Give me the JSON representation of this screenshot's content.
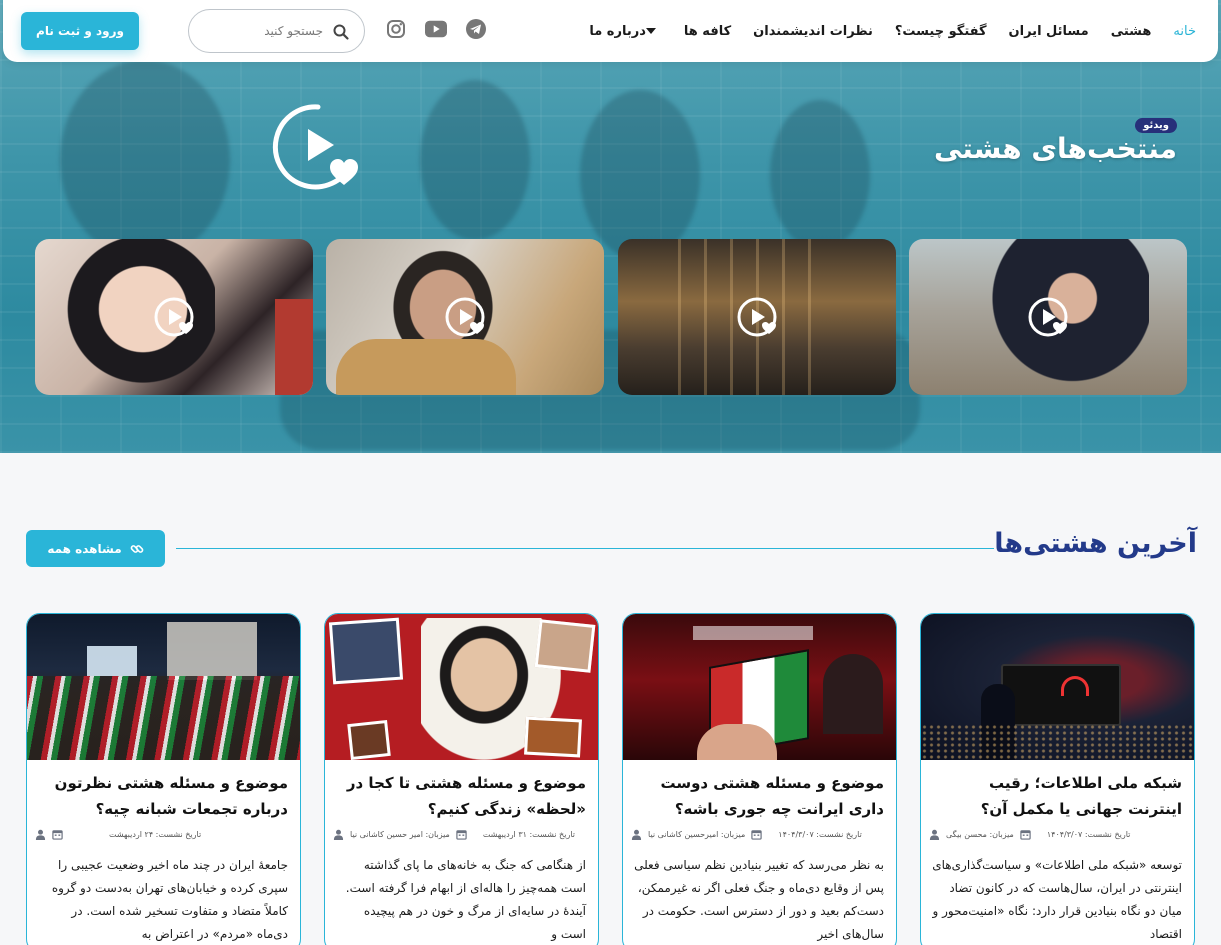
{
  "nav": {
    "links": [
      {
        "label": "خانه",
        "active": true
      },
      {
        "label": "هشتی"
      },
      {
        "label": "مسائل ایران"
      },
      {
        "label": "گفتگو چیست؟"
      },
      {
        "label": "نظرات اندیشمندان"
      },
      {
        "label": "کافه ها"
      },
      {
        "label": "درباره ما"
      }
    ],
    "search_placeholder": "جستجو کنید",
    "login_label": "ورود و ثبت نام",
    "socials": [
      "telegram-icon",
      "youtube-icon",
      "instagram-icon"
    ],
    "accent": "#2ab5d8"
  },
  "hero": {
    "badge": "ویدئو",
    "title": "منتخب‌های هشتی",
    "videos": [
      {
        "id": "v1"
      },
      {
        "id": "v2"
      },
      {
        "id": "v3"
      },
      {
        "id": "v4"
      }
    ]
  },
  "latest": {
    "title": "آخرین هشتی‌ها",
    "view_all": "مشاهده همه",
    "title_color": "#233a8a",
    "posts": [
      {
        "title": "شبکه ملی اطلاعات؛ رقیب اینترنت جهانی یا مکمل آن؟",
        "host": "میزبان: محسن بیگی",
        "date": "تاریخ نشست: ۱۴۰۴/۳/۰۷",
        "excerpt": "توسعه «شبکه ملی اطلاعات» و سیاست‌گذاری‌های اینترنتی در ایران، سال‌هاست که در کانون تضاد میان دو نگاه بنیادین قرار دارد: نگاه «امنیت‌محور و اقتصاد"
      },
      {
        "title": "موضوع و مسئله هشتی دوست داری ایرانت چه جوری باشه؟",
        "host": "میزبان: امیرحسین کاشانی نیا",
        "date": "تاریخ نشست: ۱۴۰۴/۳/۰۷",
        "excerpt": "به نظر می‌رسد که تغییر بنیادین نظم سیاسی فعلی پس از وقایع دی‌ماه و جنگ فعلی اگر نه غیرممکن، دست‌کم بعید و دور از دسترس است. حکومت در سال‌های اخیر"
      },
      {
        "title": "موضوع و مسئله هشتی تا کجا در «لحظه» زندگی کنیم؟",
        "host": "میزبان: امیر حسین کاشانی نیا",
        "date": "تاریخ نشست: ۳۱ اردیبهشت",
        "excerpt": "از هنگامی که جنگ به خانه‌های ما پای گذاشته است همه‌چیز را هاله‌ای از ابهام فرا گرفته است. آیندهٔ در سایه‌ای از مرگ و خون در هم پیچیده است و"
      },
      {
        "title": "موضوع و مسئله هشتی نظرتون درباره تجمعات شبانه چیه؟",
        "host": "",
        "date": "تاریخ نشست: ۲۴ اردیبهشت",
        "excerpt": "جامعهٔ ایران در چند ماه اخیر وضعیت عجیبی را سپری کرده و خیابان‌های تهران به‌دست دو گروه کاملاً متضاد و متفاوت تسخیر شده است. در دی‌ماه «مردم» در اعتراض به"
      }
    ]
  }
}
